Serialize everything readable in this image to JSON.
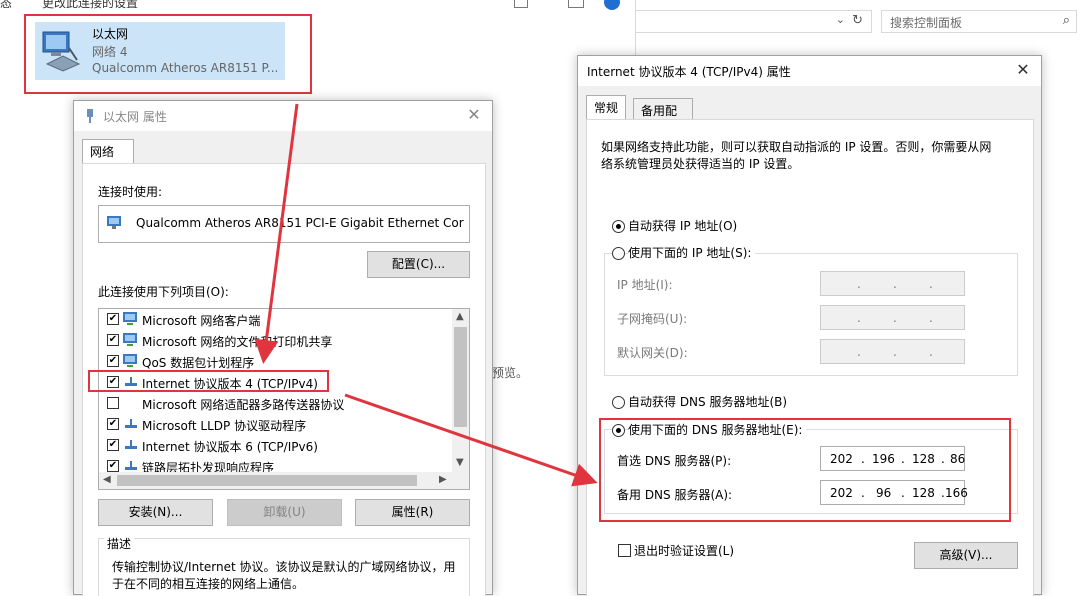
{
  "background": {
    "topbar_left": "态",
    "topbar_text": "更改此连接的设置",
    "adapter": {
      "name": "以太网",
      "network": "网络 4",
      "device": "Qualcomm Atheros AR8151 P..."
    },
    "preview_text": "预览。",
    "search_placeholder": "搜索控制面板"
  },
  "ethernet_dialog": {
    "title": "以太网 属性",
    "tab": "网络",
    "connect_using_label": "连接时使用:",
    "device_name": "Qualcomm Atheros AR8151 PCI-E Gigabit Ethernet Cor",
    "configure_button": "配置(C)...",
    "items_label": "此连接使用下列项目(O):",
    "items": [
      {
        "checked": true,
        "label": "Microsoft 网络客户端"
      },
      {
        "checked": true,
        "label": "Microsoft 网络的文件和打印机共享"
      },
      {
        "checked": true,
        "label": "QoS 数据包计划程序"
      },
      {
        "checked": true,
        "label": "Internet 协议版本 4 (TCP/IPv4)"
      },
      {
        "checked": false,
        "label": "Microsoft 网络适配器多路传送器协议"
      },
      {
        "checked": true,
        "label": "Microsoft LLDP 协议驱动程序"
      },
      {
        "checked": true,
        "label": "Internet 协议版本 6 (TCP/IPv6)"
      },
      {
        "checked": true,
        "label": "链路层拓扑发现响应程序"
      }
    ],
    "install_button": "安装(N)...",
    "uninstall_button": "卸载(U)",
    "properties_button": "属性(R)",
    "description_title": "描述",
    "description_text_1": "传输控制协议/Internet 协议。该协议是默认的广域网络协议，用",
    "description_text_2": "于在不同的相互连接的网络上通信。"
  },
  "tcpip_dialog": {
    "title": "Internet 协议版本 4 (TCP/IPv4) 属性",
    "tabs": [
      "常规",
      "备用配置"
    ],
    "intro_line_1": "如果网络支持此功能，则可以获取自动指派的 IP 设置。否则，你需要从网",
    "intro_line_2": "络系统管理员处获得适当的 IP 设置。",
    "auto_ip": "自动获得 IP 地址(O)",
    "manual_ip": "使用下面的 IP 地址(S):",
    "ip_address_label": "IP 地址(I):",
    "subnet_label": "子网掩码(U):",
    "gateway_label": "默认网关(D):",
    "auto_dns": "自动获得 DNS 服务器地址(B)",
    "manual_dns": "使用下面的 DNS 服务器地址(E):",
    "preferred_dns_label": "首选 DNS 服务器(P):",
    "alternate_dns_label": "备用 DNS 服务器(A):",
    "preferred_dns": [
      "202",
      "196",
      "128",
      "86"
    ],
    "alternate_dns": [
      "202",
      "96",
      "128",
      "166"
    ],
    "validate_on_exit": "退出时验证设置(L)",
    "advanced_button": "高级(V)..."
  },
  "colors": {
    "highlight": "#e0353f",
    "selection": "#cce4f7"
  }
}
